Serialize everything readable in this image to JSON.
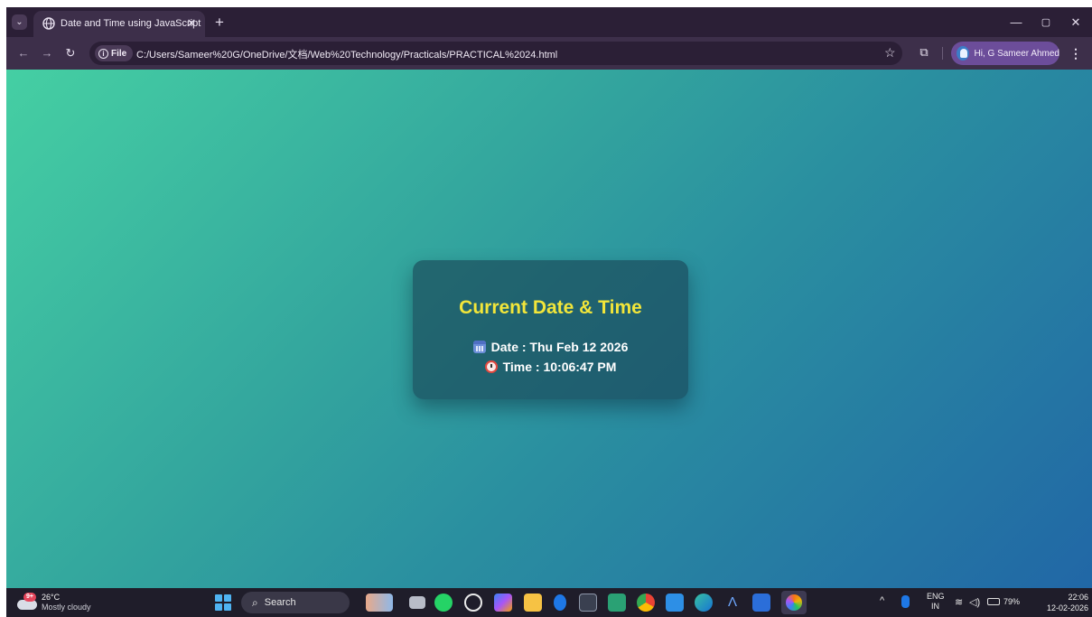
{
  "browser": {
    "tab_title": "Date and Time using JavaScript",
    "tab_close": "✕",
    "new_tab": "+",
    "chip_label": "File",
    "url": "C:/Users/Sameer%20G/OneDrive/文档/Web%20Technology/Practicals/PRACTICAL%2024.html",
    "profile_label": "Hi, G Sameer Ahmed",
    "window_controls": {
      "minimize": "—",
      "restore": "▢",
      "close": "✕"
    }
  },
  "page": {
    "heading": "Current Date & Time",
    "date_line": "Date : Thu Feb 12 2026",
    "time_line": "Time : 10:06:47 PM",
    "colors": {
      "gradient_start": "#45cfa3",
      "gradient_end": "#2167a6",
      "card": "#184052",
      "heading": "#f2e63a",
      "text": "#ffffff"
    }
  },
  "taskbar": {
    "weather_badge": "9+",
    "weather_temp": "26°C",
    "weather_desc": "Mostly cloudy",
    "search_label": "Search",
    "apps": [
      "people-app-icon",
      "file-explorer-window-icon",
      "whatsapp-icon",
      "chatgpt-icon",
      "copilot-icon",
      "folder-icon",
      "bluetooth-icon",
      "terminal-icon",
      "photos-icon",
      "chrome-icon",
      "vscode-icon",
      "edge-icon",
      "a-app-icon",
      "word-icon",
      "color-app-icon"
    ],
    "tray": {
      "chevron": "^",
      "lang_top": "ENG",
      "lang_bottom": "IN",
      "battery": "79%",
      "time": "22:06",
      "date": "12-02-2026"
    }
  }
}
